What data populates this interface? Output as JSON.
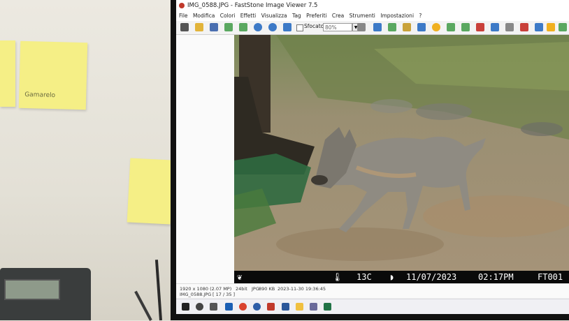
{
  "window": {
    "title": "IMG_0588.JPG - FastStone Image Viewer 7.5"
  },
  "menu": [
    "File",
    "Modifica",
    "Colori",
    "Effetti",
    "Visualizza",
    "Tag",
    "Preferiti",
    "Crea",
    "Strumenti",
    "Impostazioni",
    "?"
  ],
  "toolbar": {
    "sfocato_label": "Sfocato",
    "zoom_value": "80%"
  },
  "status": {
    "resolution": "1920 x 1080 (2.07 MP)",
    "bitdepth": "24bit",
    "format": "JPG",
    "size": "890 KB",
    "datetime": "2023-11-30 19:36:45",
    "filename": "IMG_0588.JPG",
    "position": "[ 17 / 35 ]"
  },
  "camera_overlay": {
    "temperature": "13C",
    "date": "11/07/2023",
    "time": "02:17PM",
    "camera_id": "FT001"
  },
  "sticky_note_text": "Gamarelo"
}
